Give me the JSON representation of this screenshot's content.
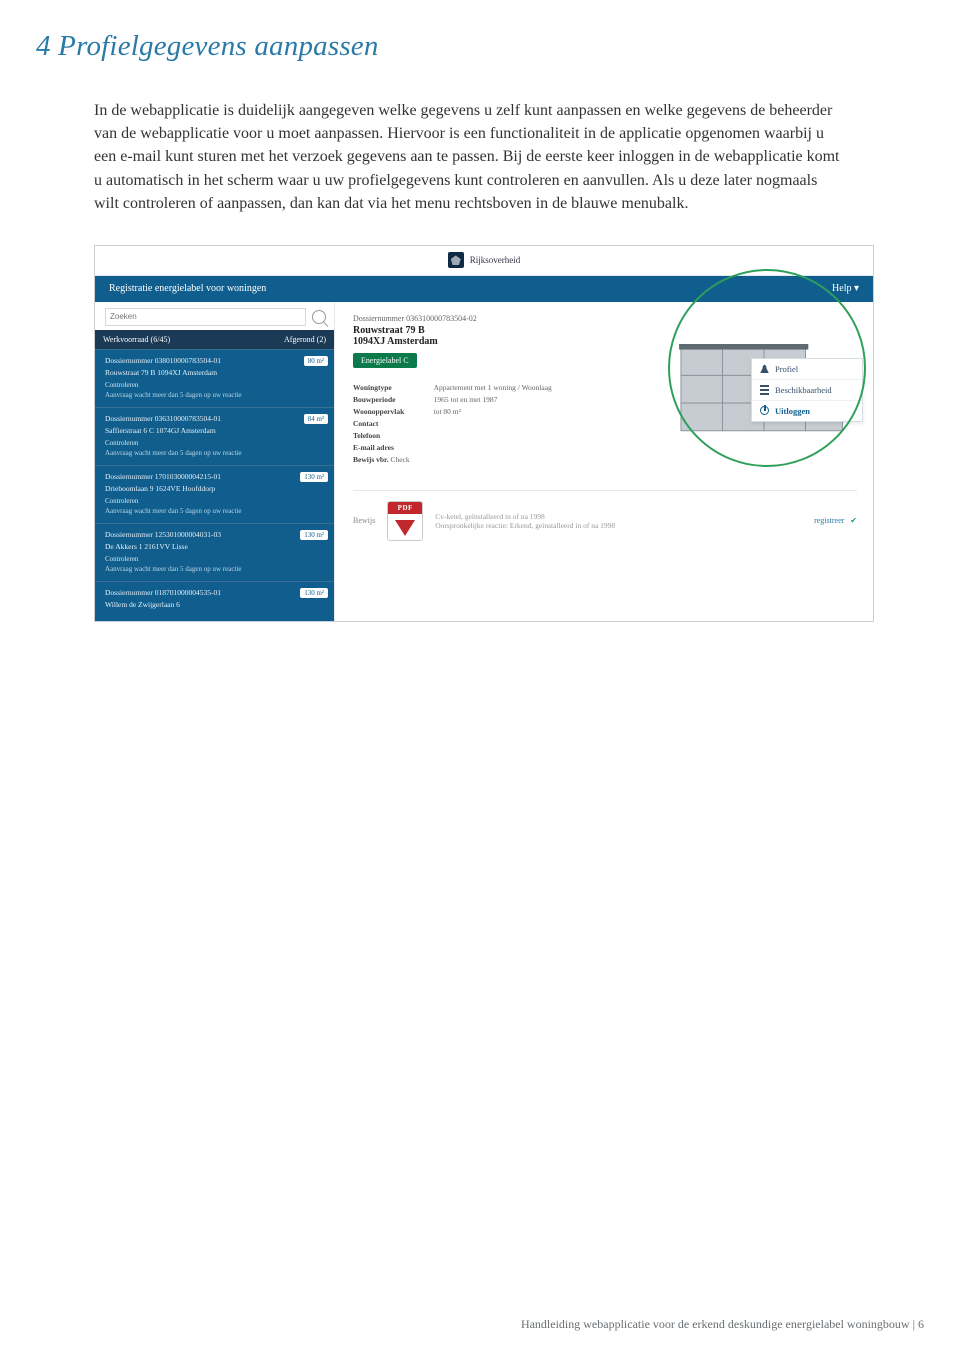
{
  "heading": "4  Profielgegevens aanpassen",
  "body": "In de webapplicatie is duidelijk aangegeven welke gegevens u zelf kunt aanpassen en welke gegevens de beheerder van de webapplicatie voor u moet aanpassen. Hiervoor is een functionaliteit in de applicatie opgenomen waarbij u een e-mail kunt sturen met het verzoek gegevens aan te passen. Bij de eerste keer inloggen in de webapplicatie komt u automatisch in het scherm waar u uw profielgegevens kunt controleren en aanvullen. Als u deze later nogmaals wilt controleren of aanpassen, dan kan dat via het menu rechtsboven in de blauwe menubalk.",
  "app": {
    "brand": "Rijksoverheid",
    "title_left": "Registratie energielabel voor woningen",
    "help_label": "Help ▾",
    "search_placeholder": "Zoeken",
    "tabhead_left": "Werkvoorraad (6/45)",
    "tabhead_right": "Afgerond (2)",
    "dossiers": [
      {
        "title": "Dossiernummer 038010000783504-01",
        "mid": "Rouwstraat 79 B\n1094XJ Amsterdam",
        "foot1": "Controleren",
        "foot2": "Aanvraag wacht meer dan 5 dagen op uw reactie",
        "chip": "80 m²"
      },
      {
        "title": "Dossiernummer 036310000783504-01",
        "mid": "Saffierstraat 6 C\n1074GJ Amsterdam",
        "foot1": "Controleren",
        "foot2": "Aanvraag wacht meer dan 5 dagen op uw reactie",
        "chip": "84 m²"
      },
      {
        "title": "Dossiernummer 170103000004215-01",
        "mid": "Drieboomlaan 9\n1624VE Hoofddorp",
        "foot1": "Controleren",
        "foot2": "Aanvraag wacht meer dan 5 dagen op uw reactie",
        "chip": "130 m²"
      },
      {
        "title": "Dossiernummer 125301000004031-03",
        "mid": "De Akkers 1\n2161VV Lisse",
        "foot1": "Controleren",
        "foot2": "Aanvraag wacht meer dan 5 dagen op uw reactie",
        "chip": "130 m²"
      },
      {
        "title": "Dossiernummer 018701000004535-01",
        "mid": "Willem de Zwijgerlaan 6",
        "foot1": "",
        "foot2": "",
        "chip": "130 m²"
      }
    ],
    "detail": {
      "dnum": "Dossiernummer 036310000783504-02",
      "addr1": "Rouwstraat 79 B",
      "addr2": "1094XJ Amsterdam",
      "badge": "Energielabel C",
      "props": {
        "k1": "Woningtype",
        "v1": "Appartement met 1 woning / Woonlaag",
        "k2": "Bouwperiode",
        "v2": "1965 tot en met 1987",
        "k3": "Woonoppervlak",
        "v3": "tot 80 m²",
        "k4": "Contact",
        "v4": "",
        "k5": "Telefoon",
        "v5": "",
        "k6": "E-mail adres",
        "v6": "",
        "k7": "Bewijs vbr.",
        "v7": "Check"
      },
      "berm": "Bewijs",
      "pdf_label": "PDF",
      "pdf_l1": "Cv-ketel, geïnstalleerd in of na 1998",
      "pdf_l2": "Oorspronkelijke reactie: Erkend, geïnstalleerd in of na 1998",
      "registered": "registreer"
    },
    "help_menu": {
      "profile": "Profiel",
      "availability": "Beschikbaarheid",
      "logout": "Uitloggen"
    }
  },
  "footer": "Handleiding webapplicatie voor de erkend deskundige energielabel woningbouw | 6"
}
